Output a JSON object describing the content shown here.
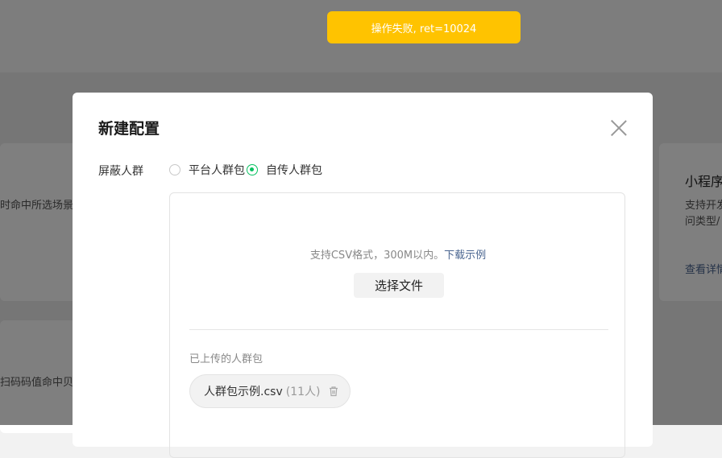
{
  "toast": {
    "text": "操作失败, ret=10024",
    "color": "#ffc300"
  },
  "background": {
    "card_left_1_text": "时命中所选场景",
    "card_left_2_text": "扫码码值命中贝",
    "card_right_title": "小程序",
    "card_right_desc_1": "支持开发",
    "card_right_desc_2": "问类型/",
    "card_right_link": "查看详情"
  },
  "dialog": {
    "title": "新建配置",
    "close_icon": "close-icon",
    "form": {
      "label": "屏蔽人群",
      "options": [
        {
          "label": "平台人群包",
          "checked": false
        },
        {
          "label": "自传人群包",
          "checked": true
        }
      ],
      "accent_color": "#07c160"
    },
    "upload": {
      "hint": "支持CSV格式，300M以内。",
      "download_link": "下载示例",
      "choose_button": "选择文件",
      "uploaded_title": "已上传的人群包",
      "file": {
        "name": "人群包示例.csv",
        "count": "(11人)",
        "delete_icon": "trash-icon"
      }
    }
  }
}
